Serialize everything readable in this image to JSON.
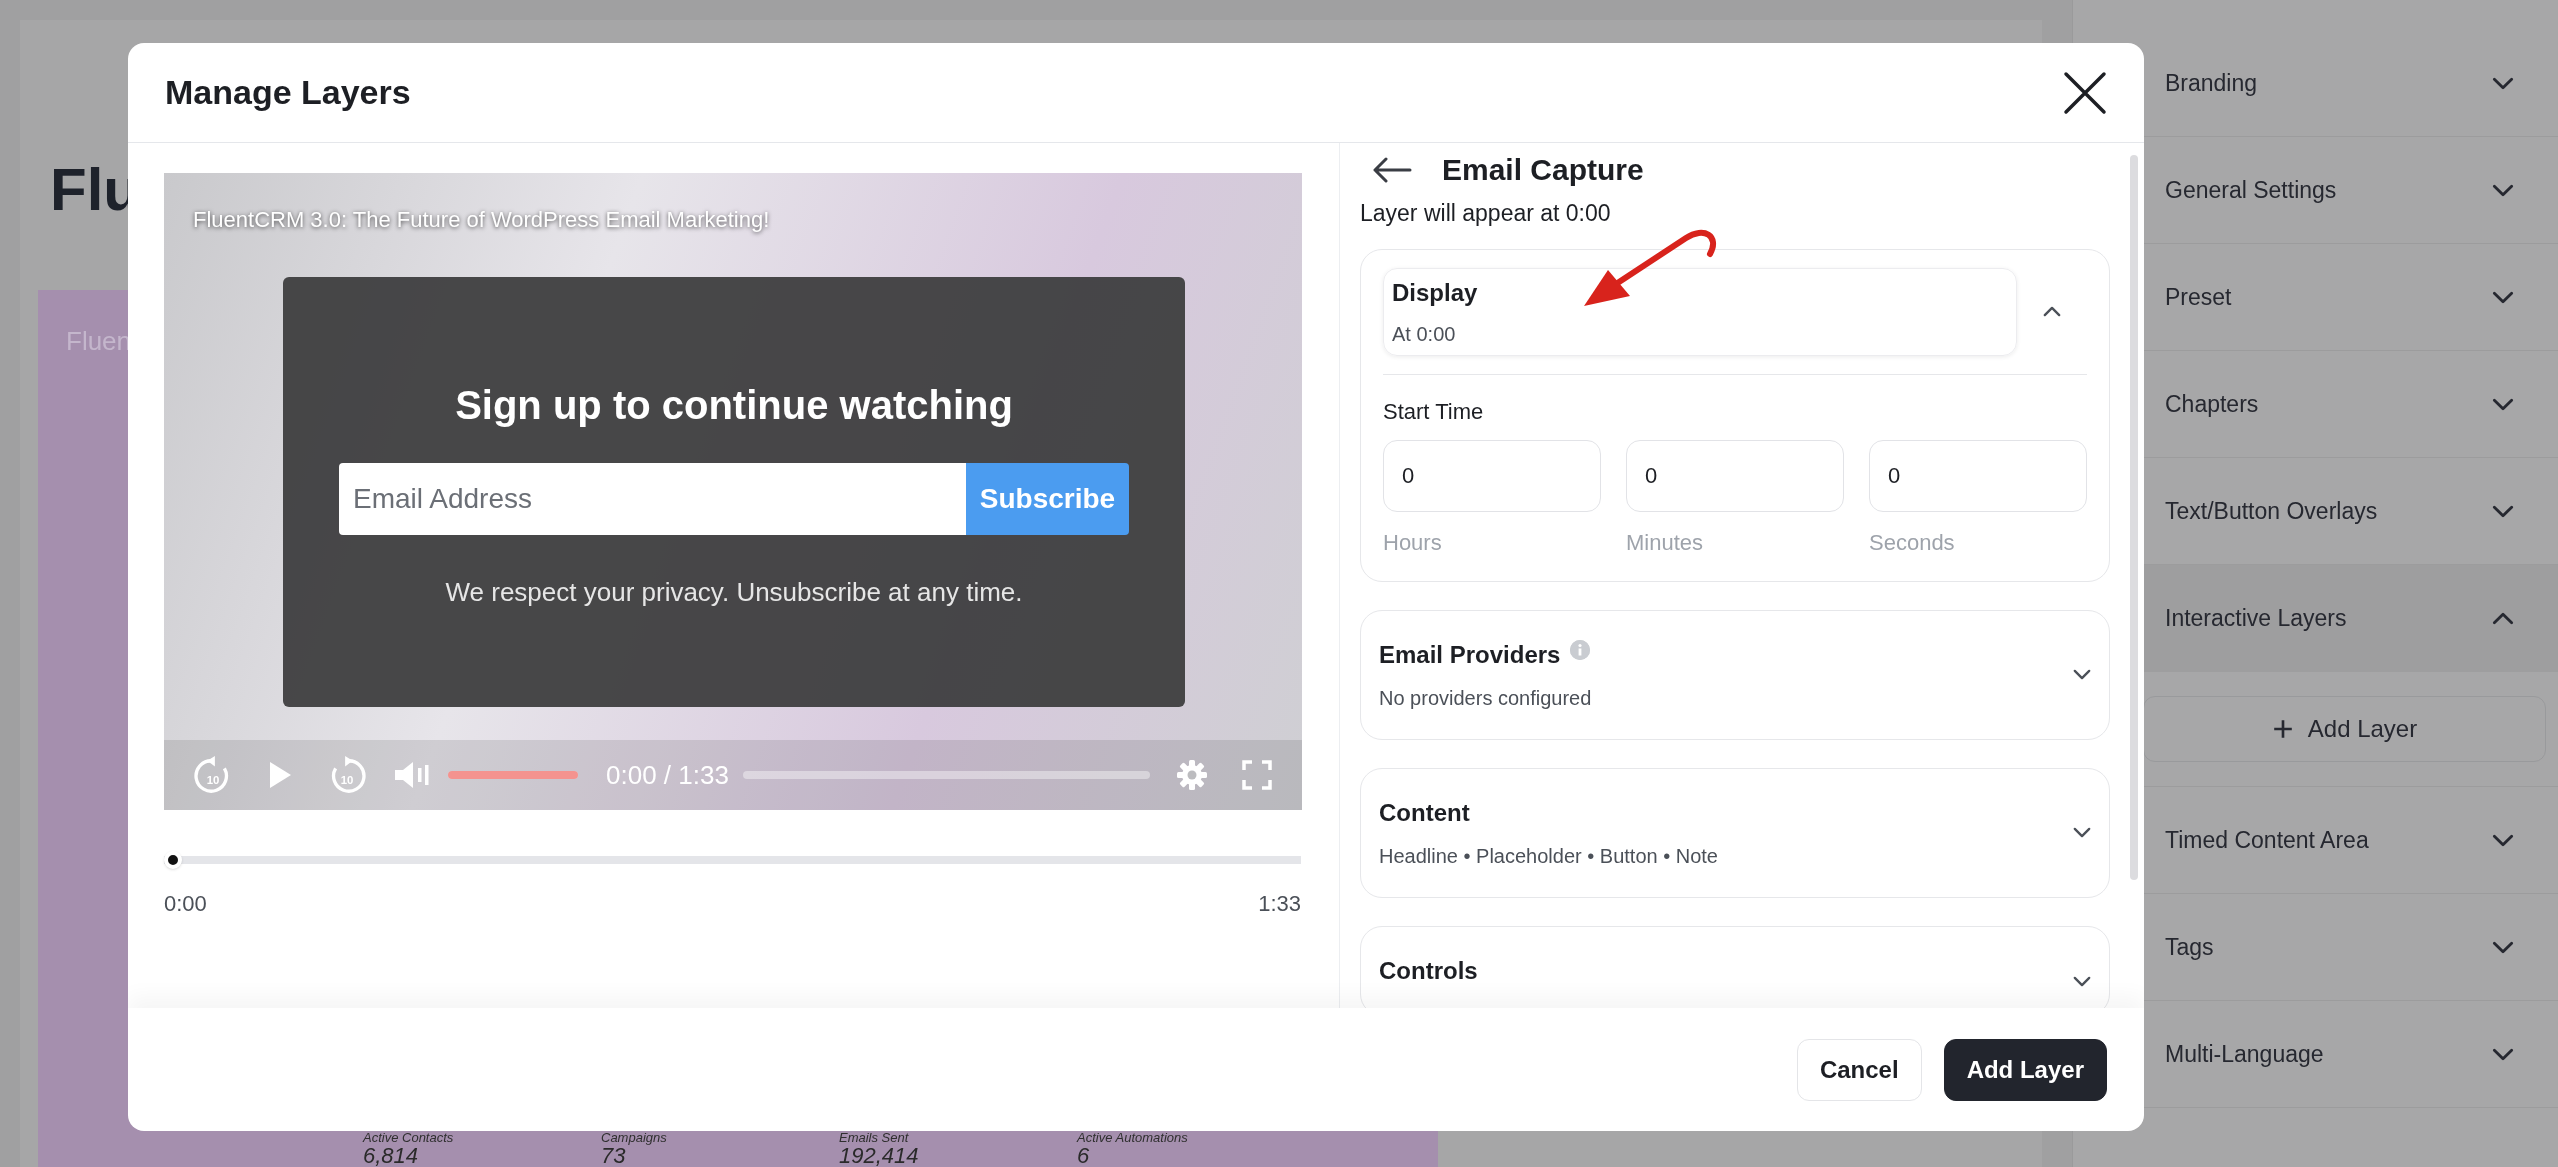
{
  "background_page": {
    "heading": "Flu",
    "card_title": "Fluen",
    "stats": [
      {
        "label": "Active Contacts",
        "value": "6,814"
      },
      {
        "label": "Campaigns",
        "value": "73"
      },
      {
        "label": "Emails Sent",
        "value": "192,414"
      },
      {
        "label": "Active Automations",
        "value": "6"
      }
    ]
  },
  "sidebar": {
    "items": [
      {
        "label": "Branding",
        "expanded": false
      },
      {
        "label": "General Settings",
        "expanded": false
      },
      {
        "label": "Preset",
        "expanded": false
      },
      {
        "label": "Chapters",
        "expanded": false
      },
      {
        "label": "Text/Button Overlays",
        "expanded": false
      },
      {
        "label": "Interactive Layers",
        "expanded": true,
        "action": "Add Layer"
      },
      {
        "label": "Timed Content Area",
        "expanded": false
      },
      {
        "label": "Tags",
        "expanded": false
      },
      {
        "label": "Multi-Language",
        "expanded": false
      }
    ]
  },
  "modal": {
    "title": "Manage Layers",
    "video": {
      "title": "FluentCRM 3.0: The Future of WordPress Email Marketing!",
      "signup": {
        "headline": "Sign up to continue watching",
        "placeholder": "Email Address",
        "button": "Subscribe",
        "note": "We respect your privacy. Unsubscribe at any time."
      },
      "controls": {
        "rewind_label": "10",
        "forward_label": "10",
        "volume": {
          "level": 1
        },
        "time": "0:00 / 1:33",
        "progress": {
          "level": 0
        }
      }
    },
    "timeline": {
      "level": 0,
      "start": "0:00",
      "end": "1:33"
    },
    "panel": {
      "title": "Email Capture",
      "subtitle": "Layer will appear at 0:00",
      "sections": [
        {
          "kind": "time",
          "title": "Display",
          "summary": "At 0:00",
          "expanded": true,
          "field_label": "Start Time",
          "fields": [
            {
              "value": "0",
              "label": "Hours"
            },
            {
              "value": "0",
              "label": "Minutes"
            },
            {
              "value": "0",
              "label": "Seconds"
            }
          ]
        },
        {
          "kind": "summary",
          "title": "Email Providers",
          "info": true,
          "summary": "No providers configured",
          "expanded": false
        },
        {
          "kind": "summary",
          "title": "Content",
          "summary": "Headline • Placeholder • Button • Note",
          "expanded": false
        },
        {
          "kind": "summary",
          "title": "Controls",
          "expanded": false
        }
      ]
    },
    "buttons": [
      {
        "label": "Cancel",
        "kind": "secondary"
      },
      {
        "label": "Add Layer",
        "kind": "primary"
      }
    ]
  }
}
